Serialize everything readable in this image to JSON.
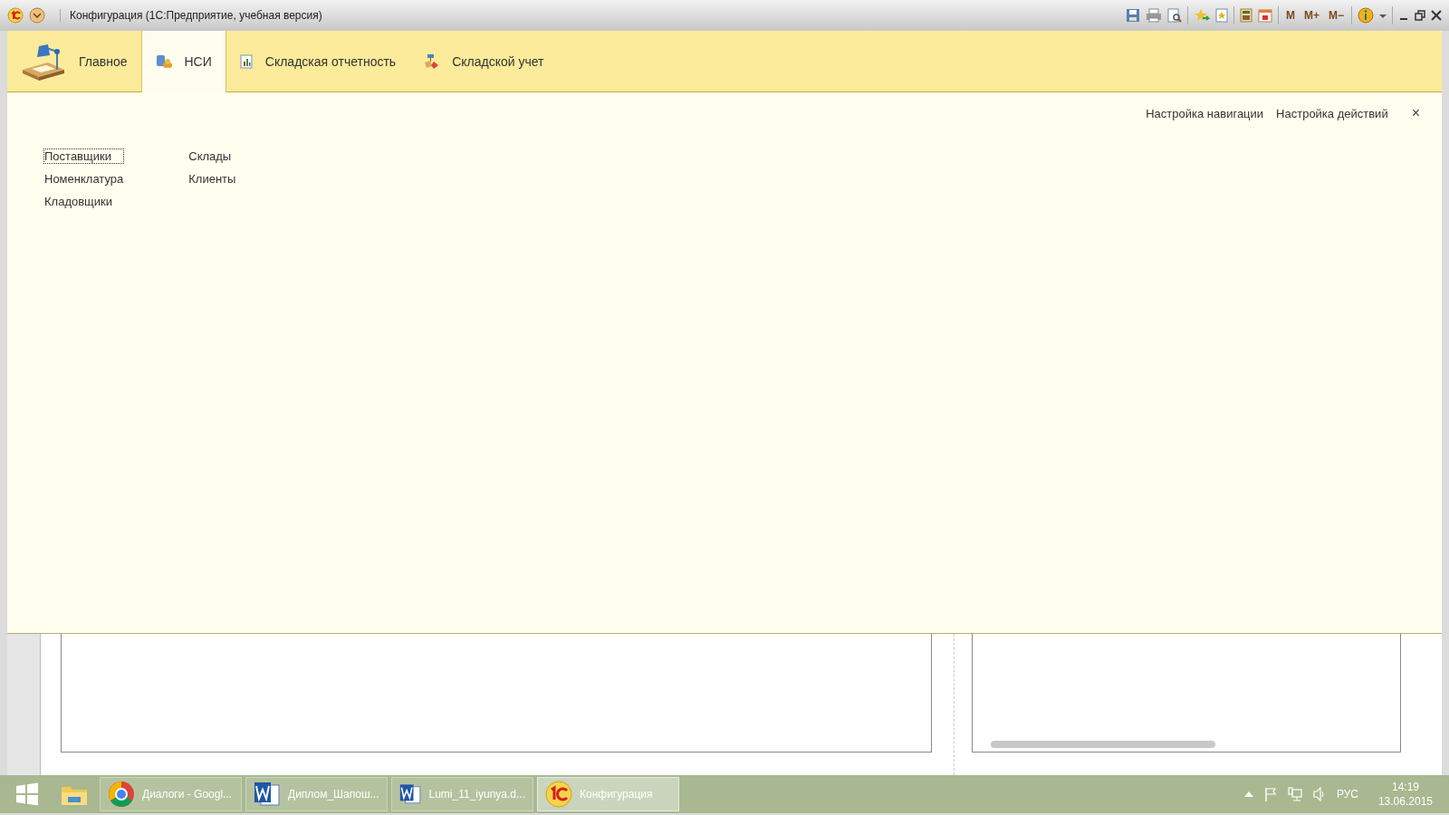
{
  "window": {
    "title": "Конфигурация  (1С:Предприятие, учебная версия)",
    "memory_buttons": [
      "M",
      "M+",
      "M−"
    ]
  },
  "sections": [
    {
      "label": "Главное",
      "kind": "lamp",
      "selected": false
    },
    {
      "label": "НСИ",
      "kind": "db",
      "selected": true
    },
    {
      "label": "Складская отчетность",
      "kind": "report",
      "selected": false
    },
    {
      "label": "Складской учет",
      "kind": "stock",
      "selected": false
    }
  ],
  "panel": {
    "links": [
      "Настройка навигации",
      "Настройка действий"
    ],
    "close": "×",
    "columns": [
      [
        {
          "label": "Поставщики",
          "selected": true
        },
        {
          "label": "Номенклатура",
          "selected": false
        },
        {
          "label": "Кладовщики",
          "selected": false
        }
      ],
      [
        {
          "label": "Склады",
          "selected": false
        },
        {
          "label": "Клиенты",
          "selected": false
        }
      ]
    ]
  },
  "taskbar": {
    "items": [
      {
        "label": "Диалоги - Googl...",
        "kind": "chrome",
        "selected": false
      },
      {
        "label": "Диплом_Шапош...",
        "kind": "word",
        "selected": false
      },
      {
        "label": "Lumi_11_iyunya.d...",
        "kind": "word",
        "selected": false
      },
      {
        "label": "Конфигурация",
        "kind": "onec",
        "selected": true
      }
    ],
    "language": "РУС",
    "time": "14:19",
    "date": "13.06.2015"
  }
}
